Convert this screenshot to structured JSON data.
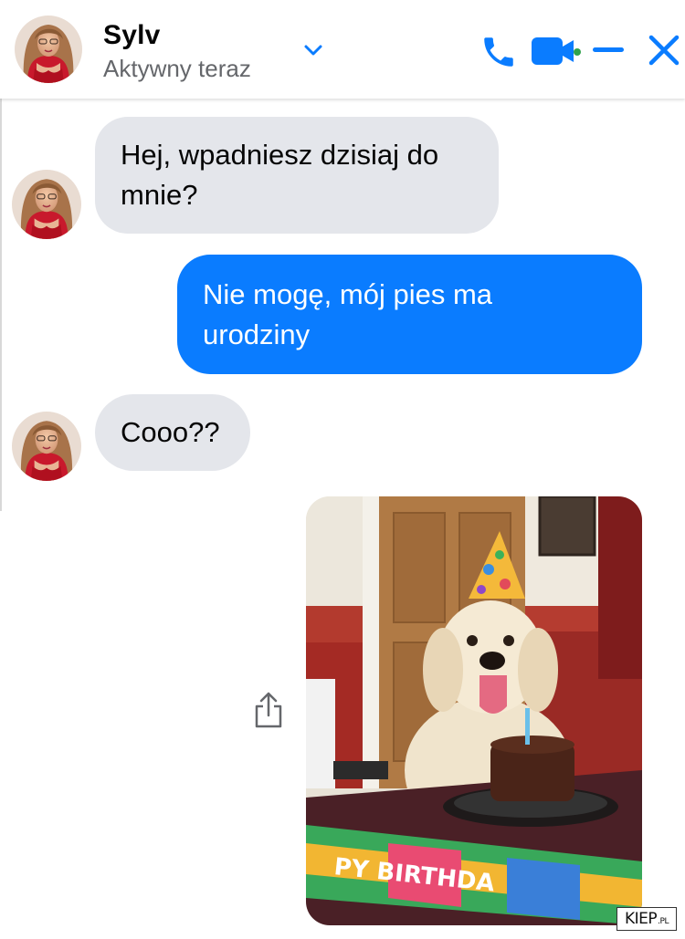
{
  "header": {
    "contact_name": "Sylv",
    "status": "Aktywny teraz",
    "icons": [
      "chevron-down-icon",
      "phone-icon",
      "video-camera-icon",
      "minimize-icon",
      "close-icon"
    ],
    "accent_color": "#0a7cff"
  },
  "messages": [
    {
      "sender": "contact",
      "text_line1": "Hej, wpadniesz dzisiaj do",
      "text_line2": "mnie?"
    },
    {
      "sender": "me",
      "text_line1": "Nie mogę, mój pies ma",
      "text_line2": "urodziny"
    },
    {
      "sender": "contact",
      "text": "Cooo??"
    }
  ],
  "photo_message": {
    "banner_text": "PY BIRTHDA",
    "share_icon": "share-icon"
  },
  "watermark": {
    "main": "KIEP",
    "suffix": ".PL"
  },
  "colors": {
    "incoming_bubble": "#e4e6eb",
    "outgoing_bubble": "#0a7cff",
    "status_text": "#65676b"
  }
}
